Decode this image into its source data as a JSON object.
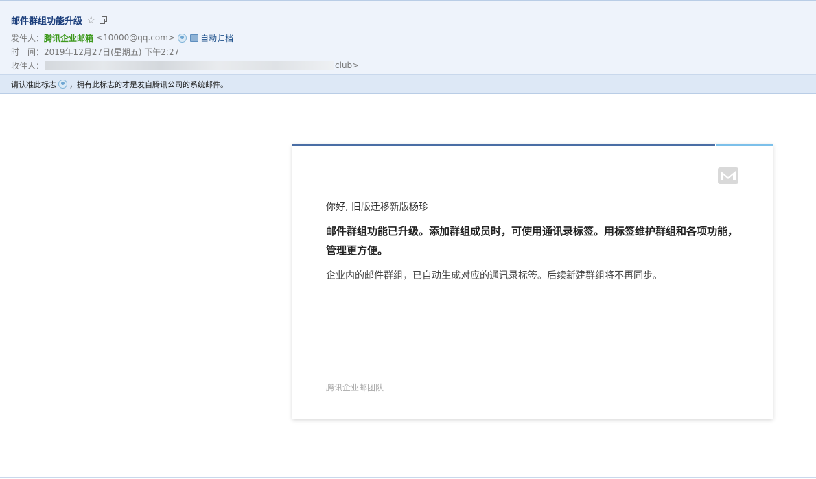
{
  "email": {
    "subject": "邮件群组功能升级",
    "from_label": "发件人：",
    "sender_name": "腾讯企业邮箱",
    "sender_address": "<10000@qq.com>",
    "archive_label": "自动归档",
    "time_label": "时　间：",
    "time_value": "2019年12月27日(星期五) 下午2:27",
    "to_label": "收件人：",
    "recipient_tail": "club>"
  },
  "notice": {
    "text_before": "请认准此标志",
    "text_after": "，拥有此标志的才是发自腾讯公司的系统邮件。"
  },
  "card": {
    "greeting": "你好, 旧版迁移新版杨珍",
    "headline": "邮件群组功能已升级。添加群组成员时，可使用通讯录标签。用标签维护群组和各项功能，管理更方便。",
    "body": "企业内的邮件群组，已自动生成对应的通讯录标签。后续新建群组将不再同步。",
    "signature": "腾讯企业邮团队"
  },
  "colors": {
    "subject": "#1c3f7c",
    "sender_name": "#3f9a1e",
    "accent_dark": "#4a6ea5",
    "accent_light": "#7cc0ea",
    "header_bg": "#eef3fb",
    "notice_bg": "#dde8f6"
  },
  "icons": [
    "star-icon",
    "popout-icon",
    "verified-badge-icon",
    "archive-icon",
    "tencent-mail-logo-icon"
  ]
}
